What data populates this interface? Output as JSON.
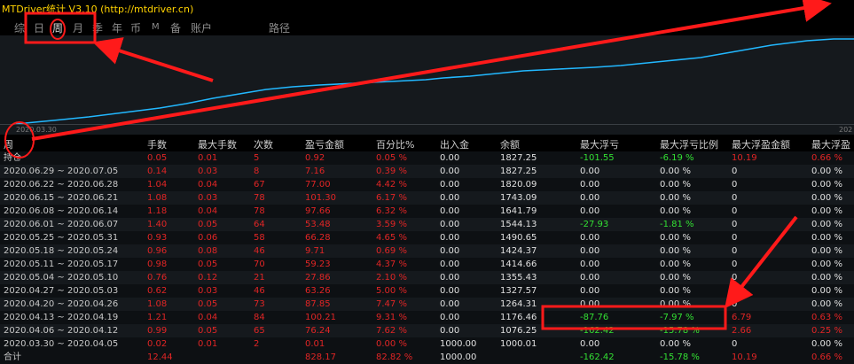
{
  "app": {
    "title": "MTDriver统计 V3.10 (http://mtdriver.cn)"
  },
  "tabs": [
    {
      "label": "综"
    },
    {
      "label": "日"
    },
    {
      "label": "周"
    },
    {
      "label": "月"
    },
    {
      "label": "季"
    },
    {
      "label": "年"
    },
    {
      "label": "币"
    },
    {
      "label": "M"
    },
    {
      "label": "备"
    },
    {
      "label": "账户"
    },
    {
      "label": "路径"
    }
  ],
  "active_tab": "周",
  "chart": {
    "x_start": "2020.03.30",
    "x_end": "202",
    "line_color": "#22b8ff",
    "background": "#15191d"
  },
  "table": {
    "headers": [
      "周",
      "手数",
      "最大手数",
      "次数",
      "盈亏金额",
      "百分比%",
      "出入金",
      "余额",
      "最大浮亏",
      "最大浮亏比例",
      "最大浮盈金额",
      "最大浮盈"
    ],
    "summary": [
      "持仓",
      "0.05",
      "0.01",
      "5",
      "0.92",
      "0.05 %",
      "0.00",
      "1827.25",
      "-101.55",
      "-6.19 %",
      "10.19",
      "0.66 %"
    ],
    "rows": [
      [
        "2020.06.29 ~ 2020.07.05",
        "0.14",
        "0.03",
        "8",
        "7.16",
        "0.39 %",
        "0.00",
        "1827.25",
        "0.00",
        "0.00 %",
        "0",
        "0.00 %"
      ],
      [
        "2020.06.22 ~ 2020.06.28",
        "1.04",
        "0.04",
        "67",
        "77.00",
        "4.42 %",
        "0.00",
        "1820.09",
        "0.00",
        "0.00 %",
        "0",
        "0.00 %"
      ],
      [
        "2020.06.15 ~ 2020.06.21",
        "1.08",
        "0.03",
        "78",
        "101.30",
        "6.17 %",
        "0.00",
        "1743.09",
        "0.00",
        "0.00 %",
        "0",
        "0.00 %"
      ],
      [
        "2020.06.08 ~ 2020.06.14",
        "1.18",
        "0.04",
        "78",
        "97.66",
        "6.32 %",
        "0.00",
        "1641.79",
        "0.00",
        "0.00 %",
        "0",
        "0.00 %"
      ],
      [
        "2020.06.01 ~ 2020.06.07",
        "1.40",
        "0.05",
        "64",
        "53.48",
        "3.59 %",
        "0.00",
        "1544.13",
        "-27.93",
        "-1.81 %",
        "0",
        "0.00 %"
      ],
      [
        "2020.05.25 ~ 2020.05.31",
        "0.93",
        "0.06",
        "58",
        "66.28",
        "4.65 %",
        "0.00",
        "1490.65",
        "0.00",
        "0.00 %",
        "0",
        "0.00 %"
      ],
      [
        "2020.05.18 ~ 2020.05.24",
        "0.96",
        "0.08",
        "46",
        "9.71",
        "0.69 %",
        "0.00",
        "1424.37",
        "0.00",
        "0.00 %",
        "0",
        "0.00 %"
      ],
      [
        "2020.05.11 ~ 2020.05.17",
        "0.98",
        "0.05",
        "70",
        "59.23",
        "4.37 %",
        "0.00",
        "1414.66",
        "0.00",
        "0.00 %",
        "0",
        "0.00 %"
      ],
      [
        "2020.05.04 ~ 2020.05.10",
        "0.76",
        "0.12",
        "21",
        "27.86",
        "2.10 %",
        "0.00",
        "1355.43",
        "0.00",
        "0.00 %",
        "0",
        "0.00 %"
      ],
      [
        "2020.04.27 ~ 2020.05.03",
        "0.62",
        "0.03",
        "46",
        "63.26",
        "5.00 %",
        "0.00",
        "1327.57",
        "0.00",
        "0.00 %",
        "0",
        "0.00 %"
      ],
      [
        "2020.04.20 ~ 2020.04.26",
        "1.08",
        "0.05",
        "73",
        "87.85",
        "7.47 %",
        "0.00",
        "1264.31",
        "0.00",
        "0.00 %",
        "0",
        "0.00 %"
      ],
      [
        "2020.04.13 ~ 2020.04.19",
        "1.21",
        "0.04",
        "84",
        "100.21",
        "9.31 %",
        "0.00",
        "1176.46",
        "-87.76",
        "-7.97 %",
        "6.79",
        "0.63 %"
      ],
      [
        "2020.04.06 ~ 2020.04.12",
        "0.99",
        "0.05",
        "65",
        "76.24",
        "7.62 %",
        "0.00",
        "1076.25",
        "-162.42",
        "-15.78 %",
        "2.66",
        "0.25 %"
      ],
      [
        "2020.03.30 ~ 2020.04.05",
        "0.02",
        "0.01",
        "2",
        "0.01",
        "0.00 %",
        "1000.00",
        "1000.01",
        "0.00",
        "0.00 %",
        "0",
        "0.00 %"
      ]
    ],
    "total": [
      "合计",
      "12.44",
      "",
      "",
      "828.17",
      "82.82 %",
      "1000.00",
      "",
      "-162.42",
      "-15.78 %",
      "10.19",
      "0.66 %"
    ]
  },
  "colors": {
    "positive": "#e02525",
    "neutral": "#e0e0e0",
    "negative": "#33e033",
    "annotation": "#ff1a1a"
  }
}
